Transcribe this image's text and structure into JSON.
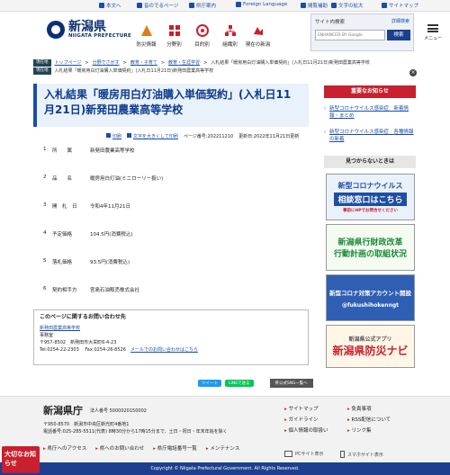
{
  "util_bar": {
    "items": [
      "本文へ",
      "音のでるページ",
      "県庁案内",
      "Foreign Language",
      "閲覧補助",
      "文字の拡大",
      "サイトマップ"
    ]
  },
  "header": {
    "logo_jp": "新潟県",
    "logo_en": "NIIGATA PREFECTURE",
    "nav": [
      "防災情報",
      "分野別",
      "目的別",
      "組織別",
      "現在の新潟"
    ],
    "search_label": "サイト内検索",
    "search_advanced": "詳細検索",
    "search_placeholder": "ENHANCED BY Google",
    "search_button": "検索",
    "menu_label": "メニュー"
  },
  "breadcrumb": {
    "tag": "現在地",
    "items": [
      "トップページ",
      "分野でさがす",
      "教育・子育て",
      "教育・生涯学習",
      "入札結果「暖房用白灯油購入単価契約」(入札日11月21日)新発田農業高等学校"
    ],
    "current_repeat": "入札結果「暖房用白灯油購入単価契約」(入札日11月21日)新発田農業高等学校",
    "close": "×"
  },
  "main": {
    "title": "入札結果「暖房用白灯油購入単価契約」(入札日11月21日)新発田農業高等学校",
    "print": "印刷",
    "enlarge": "文字を大きくして印刷",
    "page_id": "ページ番号:202211210",
    "updated": "更新日:2022年11月21日更新",
    "spec": [
      {
        "num": "1",
        "label": "所　　属",
        "value": "新発田農業高等学校"
      },
      {
        "num": "2",
        "label": "品　　名",
        "value": "暖房用白灯油(ミニローリー扱い)"
      },
      {
        "num": "3",
        "label": "開　札　日",
        "value": "令和4年11月21日"
      },
      {
        "num": "4",
        "label": "予定価格",
        "value": "104.5円(消費税込)"
      },
      {
        "num": "5",
        "label": "落札価格",
        "value": "93.5円(消費税込)"
      },
      {
        "num": "6",
        "label": "契約相手方",
        "value": "宮島石油販売株式会社"
      }
    ]
  },
  "contact": {
    "heading": "このページに関するお問い合わせ先",
    "org": "新発田農業高等学校",
    "dept": "事務室",
    "zip": "〒957-8502　新発田市大栄町6-4-23",
    "tel": "Tel:0254-22-2303　 Fax:0254-26-8526",
    "form_link": "メールでのお問い合わせはこちら"
  },
  "share": {
    "tweet": "ツイート",
    "line": "LINEで送る",
    "all_sns": "県公式SNS一覧へ"
  },
  "sidebar": {
    "important_heading": "重要なお知らせ",
    "notices": [
      "新型コロナウイルス感染症　新着情報・まとめ",
      "新型コロナウイルス感染症　各種情報の新着"
    ],
    "find_heading": "見つからないときは",
    "banners": [
      {
        "line1": "新型コロナウイルス",
        "line2": "相談窓口はこちら",
        "line3": "事前にHPでお問合せください",
        "color": "#1d4fa0"
      },
      {
        "line1": "新潟県行財政改革",
        "line2": "行動計画の取組状況",
        "line3": "",
        "color": "#1b8a3a"
      },
      {
        "line1": "新型コロナ対策アカウント開設",
        "line2": "@fukushihokenngt",
        "line3": "",
        "color": "#2f5fb3"
      },
      {
        "line1": "新潟県公式アプリ",
        "line2": "新潟県防災ナビ",
        "line3": "",
        "color": "#c8202e"
      }
    ]
  },
  "footer": {
    "title": "新潟県庁",
    "corp": "法人番号 5000020150002",
    "address": "〒950-8570　新潟市中央区新光町4番地1",
    "tel": "電話番号:025-285-5511(代表) 8時30分から17時15分まで、土日・祝日・年末年始を除く",
    "links": [
      "県庁へのアクセス",
      "県へのお問い合わせ",
      "県庁電話番号一覧",
      "メンテナンス"
    ],
    "right_links": [
      "サイトマップ",
      "免責事項",
      "ガイドライン",
      "RSS配信について",
      "個人情報の取扱い",
      "リンク集"
    ],
    "pc_site": "PCサイト表示",
    "sp_site": "スマホサイト表示",
    "copyright": "Copyright © Niigata Prefectural Government. All Rights Reserved.",
    "taisetsu": "大切なお知らせ"
  }
}
